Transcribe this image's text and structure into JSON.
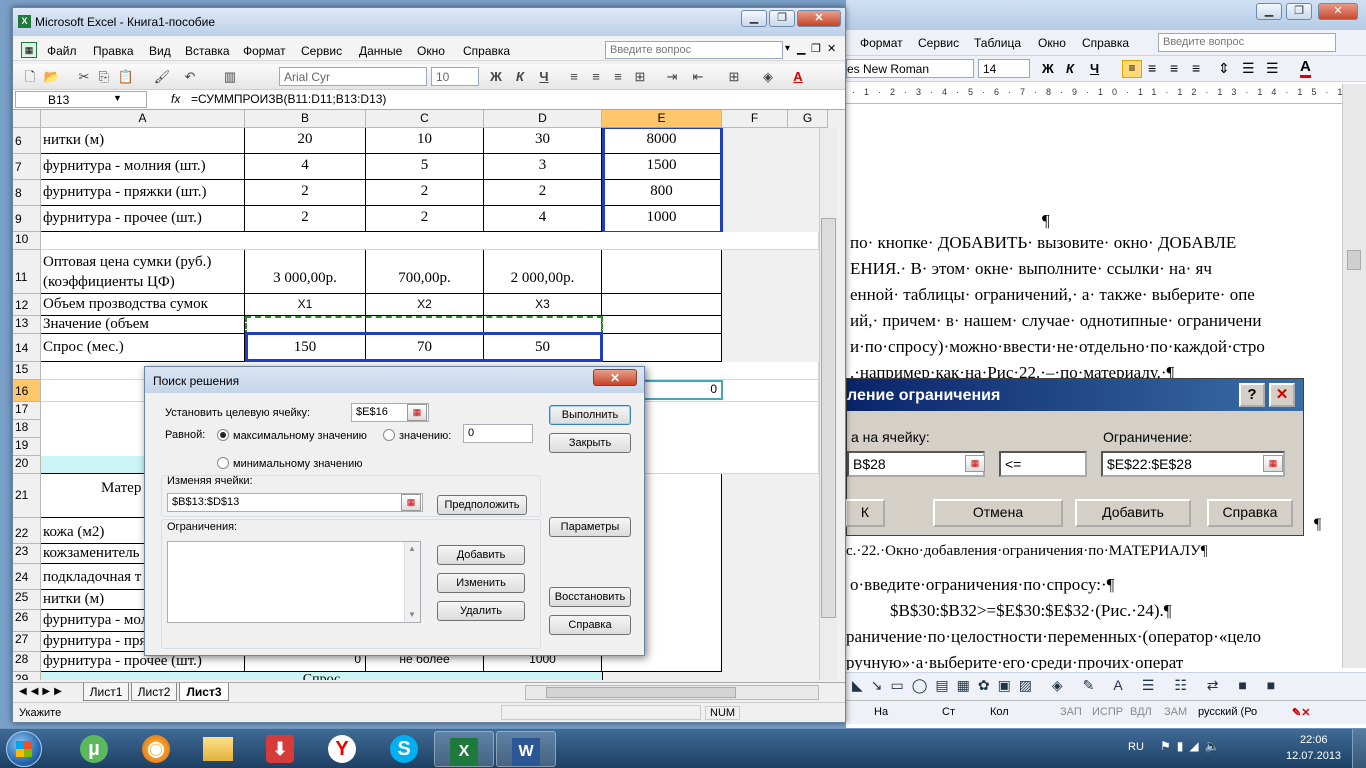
{
  "word": {
    "menu": [
      "Формат",
      "Сервис",
      "Таблица",
      "Окно",
      "Справка"
    ],
    "ask": "Введите вопрос",
    "font": "es New Roman",
    "size": "14",
    "doc_lines": [
      "¶",
      "по· кнопке· ДОБАВИТЬ· вызовите· окно· ДОБАВЛЕ",
      "ЕНИЯ.· В· этом· окне· выполните· ссылки· на· яч",
      "енной· таблицы· ограничений,· а· также· выберите· опе",
      "ий,· причем· в· нашем· случае· однотипные· ограничени",
      "и·по·спросу)·можно·ввести·не·отдельно·по·каждой·стро",
      ",·например·как·на·Рис·22.·–·по·материалу.·¶",
      "с.·22.·Окно·добавления·ограничения·по·МАТЕРИАЛУ¶",
      "о·введите·ограничения·по·спросу:·¶",
      "$B$30:$B32>=$E$30:$E$32·(Рис.·24).¶",
      "раничение·по·целостности·переменных·(оператор·«цело",
      "ручную»·а·выберите·его·среди·прочих·операт"
    ],
    "dlg": {
      "title": "ление ограничения",
      "cell_label": "а на ячейку:",
      "cell_value": "B$28",
      "op": "<=",
      "constraint_label": "Ограничение:",
      "constraint_value": "$E$22:$E$28",
      "ok": "К",
      "cancel": "Отмена",
      "add": "Добавить",
      "help": "Справка",
      "help_btn": "?"
    },
    "status": {
      "na": "На",
      "st": "Ст",
      "kol": "Кол",
      "zap": "ЗАП",
      "ispr": "ИСПР",
      "vdl": "ВДЛ",
      "zam": "ЗАМ",
      "lang": "русский (Ро"
    }
  },
  "excel": {
    "title": "Microsoft Excel - Книга1-пособие",
    "menu": [
      "Файл",
      "Правка",
      "Вид",
      "Вставка",
      "Формат",
      "Сервис",
      "Данные",
      "Окно",
      "Справка"
    ],
    "ask": "Введите вопрос",
    "font": "Arial Cyr",
    "size": "10",
    "namebox": "B13",
    "fx": "fx",
    "formula": "=СУММПРОИЗВ(B11:D11;B13:D13)",
    "columns": [
      "A",
      "B",
      "C",
      "D",
      "E",
      "F",
      "G"
    ],
    "rows": [
      {
        "n": "6",
        "a": "нитки (м)",
        "b": "20",
        "c": "10",
        "d": "30",
        "e": "8000"
      },
      {
        "n": "7",
        "a": "фурнитура - молния (шт.)",
        "b": "4",
        "c": "5",
        "d": "3",
        "e": "1500"
      },
      {
        "n": "8",
        "a": "фурнитура - пряжки (шт.)",
        "b": "2",
        "c": "2",
        "d": "2",
        "e": "800"
      },
      {
        "n": "9",
        "a": "фурнитура - прочее (шт.)",
        "b": "2",
        "c": "2",
        "d": "4",
        "e": "1000"
      }
    ],
    "r10": "10",
    "r11": {
      "n": "11",
      "a1": "Оптовая цена сумки (руб.)",
      "a2": "(коэффициенты ЦФ)",
      "b": "3 000,00р.",
      "c": "700,00р.",
      "d": "2 000,00р."
    },
    "r12": {
      "n": "12",
      "a": "Объем прозводства сумок",
      "b": "X1",
      "c": "X2",
      "d": "X3"
    },
    "r13": {
      "n": "13",
      "a": "Значение (объем"
    },
    "r14": {
      "n": "14",
      "a": "Спрос (мес.)",
      "b": "150",
      "c": "70",
      "d": "50"
    },
    "r15": "15",
    "r16": {
      "n": "16",
      "e": "0"
    },
    "lower_rows": [
      {
        "n": "17",
        "a": ""
      },
      {
        "n": "18",
        "a": ""
      },
      {
        "n": "19",
        "a": ""
      },
      {
        "n": "20",
        "a": ""
      },
      {
        "n": "21",
        "a": "Матер"
      },
      {
        "n": "22",
        "a": "кожа (м2)"
      },
      {
        "n": "23",
        "a": "кожзаменитель"
      },
      {
        "n": "24",
        "a": "подкладочная т"
      },
      {
        "n": "25",
        "a": "нитки (м)"
      },
      {
        "n": "26",
        "a": "фурнитура - мол"
      },
      {
        "n": "27",
        "a": "фурнитура - пря"
      },
      {
        "n": "28",
        "a": "фурнитура - прочее (шт.)",
        "b": "0",
        "c": "не более",
        "d": "1000"
      },
      {
        "n": "29",
        "a": "Спрос"
      }
    ],
    "sheets": [
      "Лист1",
      "Лист2",
      "Лист3"
    ],
    "status_left": "Укажите",
    "status_num": "NUM"
  },
  "solver": {
    "title": "Поиск решения",
    "close": "✕",
    "target_label": "Установить целевую ячейку:",
    "target_value": "$E$16",
    "equal_label": "Равной:",
    "max_label": "максимальному значению",
    "value_label": "значению:",
    "value_value": "0",
    "min_label": "минимальному значению",
    "changing_label": "Изменяя ячейки:",
    "changing_value": "$B$13:$D$13",
    "guess": "Предположить",
    "constraints_label": "Ограничения:",
    "run": "Выполнить",
    "close_btn": "Закрыть",
    "options": "Параметры",
    "add": "Добавить",
    "change": "Изменить",
    "delete": "Удалить",
    "reset": "Восстановить",
    "help": "Справка"
  },
  "taskbar": {
    "lang": "RU",
    "time": "22:06",
    "date": "12.07.2013"
  }
}
